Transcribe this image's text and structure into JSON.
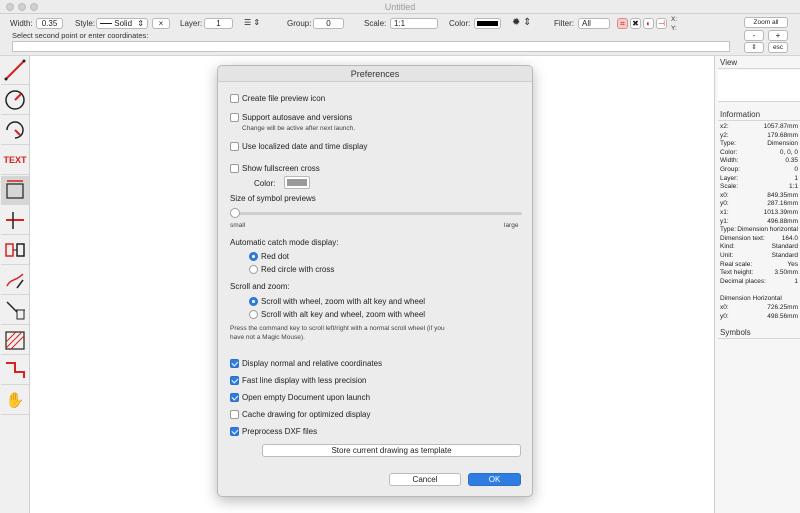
{
  "window": {
    "title": "Untitled"
  },
  "toolbar": {
    "width_label": "Width:",
    "width_value": "0.35",
    "style_label": "Style:",
    "style_value": "Solid",
    "style_clear": "×",
    "layer_label": "Layer:",
    "layer_value": "1",
    "group_label": "Group:",
    "group_value": "0",
    "scale_label": "Scale:",
    "scale_value": "1:1",
    "color_label": "Color:",
    "filter_label": "Filter:",
    "filter_value": "All",
    "xy_x": "X:",
    "xy_y": "Y:",
    "zoom_all": "Zoom all",
    "zoom_minus": "-",
    "zoom_plus": "+",
    "esc": "esc",
    "prompt": "Select second point or enter coordinates:"
  },
  "tools": [
    "line-tool-icon",
    "circle-tool-icon",
    "arc-tool-icon",
    "text-tool-icon",
    "dimension-tool-icon",
    "orthogonal-tool-icon",
    "copy-tool-icon",
    "edit-tool-icon",
    "delete-tool-icon",
    "hatch-tool-icon",
    "polyline-tool-icon",
    "hand-tool-icon"
  ],
  "tools_text": "TEXT",
  "panels": {
    "view_title": "View",
    "info_title": "Information",
    "info_rows": [
      {
        "k": "x2:",
        "v": "1057.87mm"
      },
      {
        "k": "y2:",
        "v": "179.68mm"
      },
      {
        "k": "Type:",
        "v": "Dimension"
      },
      {
        "k": "Color:",
        "v": "0, 0, 0"
      },
      {
        "k": "Width:",
        "v": "0.35"
      },
      {
        "k": "Group:",
        "v": "0"
      },
      {
        "k": "Layer:",
        "v": "1"
      },
      {
        "k": "Scale:",
        "v": "1:1"
      },
      {
        "k": "x0:",
        "v": "849.35mm"
      },
      {
        "k": "y0:",
        "v": "287.16mm"
      },
      {
        "k": "x1:",
        "v": "1013.39mm"
      },
      {
        "k": "y1:",
        "v": "496.88mm"
      },
      {
        "k": "Type:",
        "v": "Dimension horizontal"
      },
      {
        "k": "Dimension text:",
        "v": "164.0"
      },
      {
        "k": "Kind:",
        "v": "Standard"
      },
      {
        "k": "Unit:",
        "v": "Standard"
      },
      {
        "k": "Real scale:",
        "v": "Yes"
      },
      {
        "k": "Text height:",
        "v": "3.50mm"
      },
      {
        "k": "Decimal places:",
        "v": "1"
      }
    ],
    "dim_title": "Dimension Horizontal",
    "dim_rows": [
      {
        "k": "x0:",
        "v": "726.25mm"
      },
      {
        "k": "y0:",
        "v": "498.56mm"
      }
    ],
    "symbols_title": "Symbols"
  },
  "dialog": {
    "title": "Preferences",
    "create_preview": "Create file preview icon",
    "autosave": "Support autosave and versions",
    "autosave_note": "Change will be active after next launch.",
    "localized_date": "Use localized date and time display",
    "fullscreen_cross": "Show fullscreen cross",
    "color_label": "Color:",
    "symbol_size": "Size of symbol previews",
    "small": "small",
    "large": "large",
    "catch_mode": "Automatic catch mode display:",
    "catch_options": [
      "Red dot",
      "Red circle with cross"
    ],
    "catch_selected_label": "Red dot",
    "scroll_zoom": "Scroll and zoom:",
    "scroll_options": [
      "Scroll with wheel, zoom with alt key and wheel",
      "Scroll with alt key and wheel, zoom with wheel"
    ],
    "scroll_note_1": "Press the command key to scroll left/right with a normal scroll wheel (if you",
    "scroll_note_2": "have not a Magic Mouse).",
    "display_coords": "Display normal and relative coordinates",
    "fast_line": "Fast line display with less precision",
    "open_empty": "Open empty Document upon launch",
    "cache_drawing": "Cache drawing for optimized display",
    "preprocess_dxf": "Preprocess DXF files",
    "store_template": "Store current drawing as template",
    "cancel": "Cancel",
    "ok": "OK",
    "checks": {
      "create_preview": false,
      "autosave": false,
      "localized_date": false,
      "fullscreen_cross": false,
      "display_coords": true,
      "fast_line": true,
      "open_empty": true,
      "cache_drawing": false,
      "preprocess_dxf": true
    },
    "symbol_size_value": 0.0,
    "fullscreen_cross_color": "#9a9a9a"
  },
  "colors": {
    "accent": "#2f7de1",
    "tool_red": "#d8221c"
  }
}
